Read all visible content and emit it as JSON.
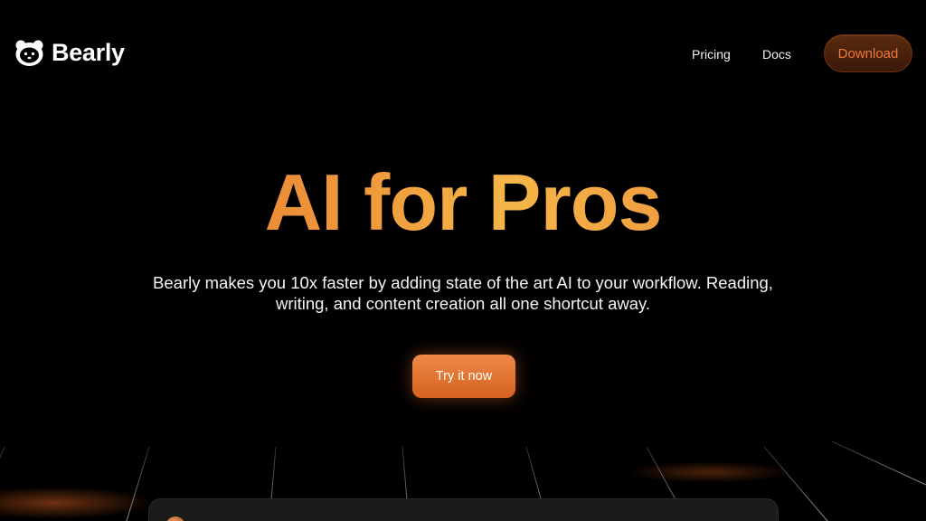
{
  "brand": {
    "name": "Bearly",
    "logo_icon": "bear-face-icon"
  },
  "nav": {
    "pricing_label": "Pricing",
    "docs_label": "Docs",
    "download_label": "Download"
  },
  "hero": {
    "title": "AI for Pros",
    "subtitle_line1": "Bearly makes you 10x faster by adding state of the art AI to your workflow. Reading,",
    "subtitle_line2": "writing, and content creation all one shortcut away.",
    "cta_label": "Try it now"
  },
  "colors": {
    "background": "#000000",
    "accent": "#e9762f",
    "title_gradient_start": "#e3692c",
    "title_gradient_mid": "#f5b648",
    "download_text": "#ef7a35"
  }
}
